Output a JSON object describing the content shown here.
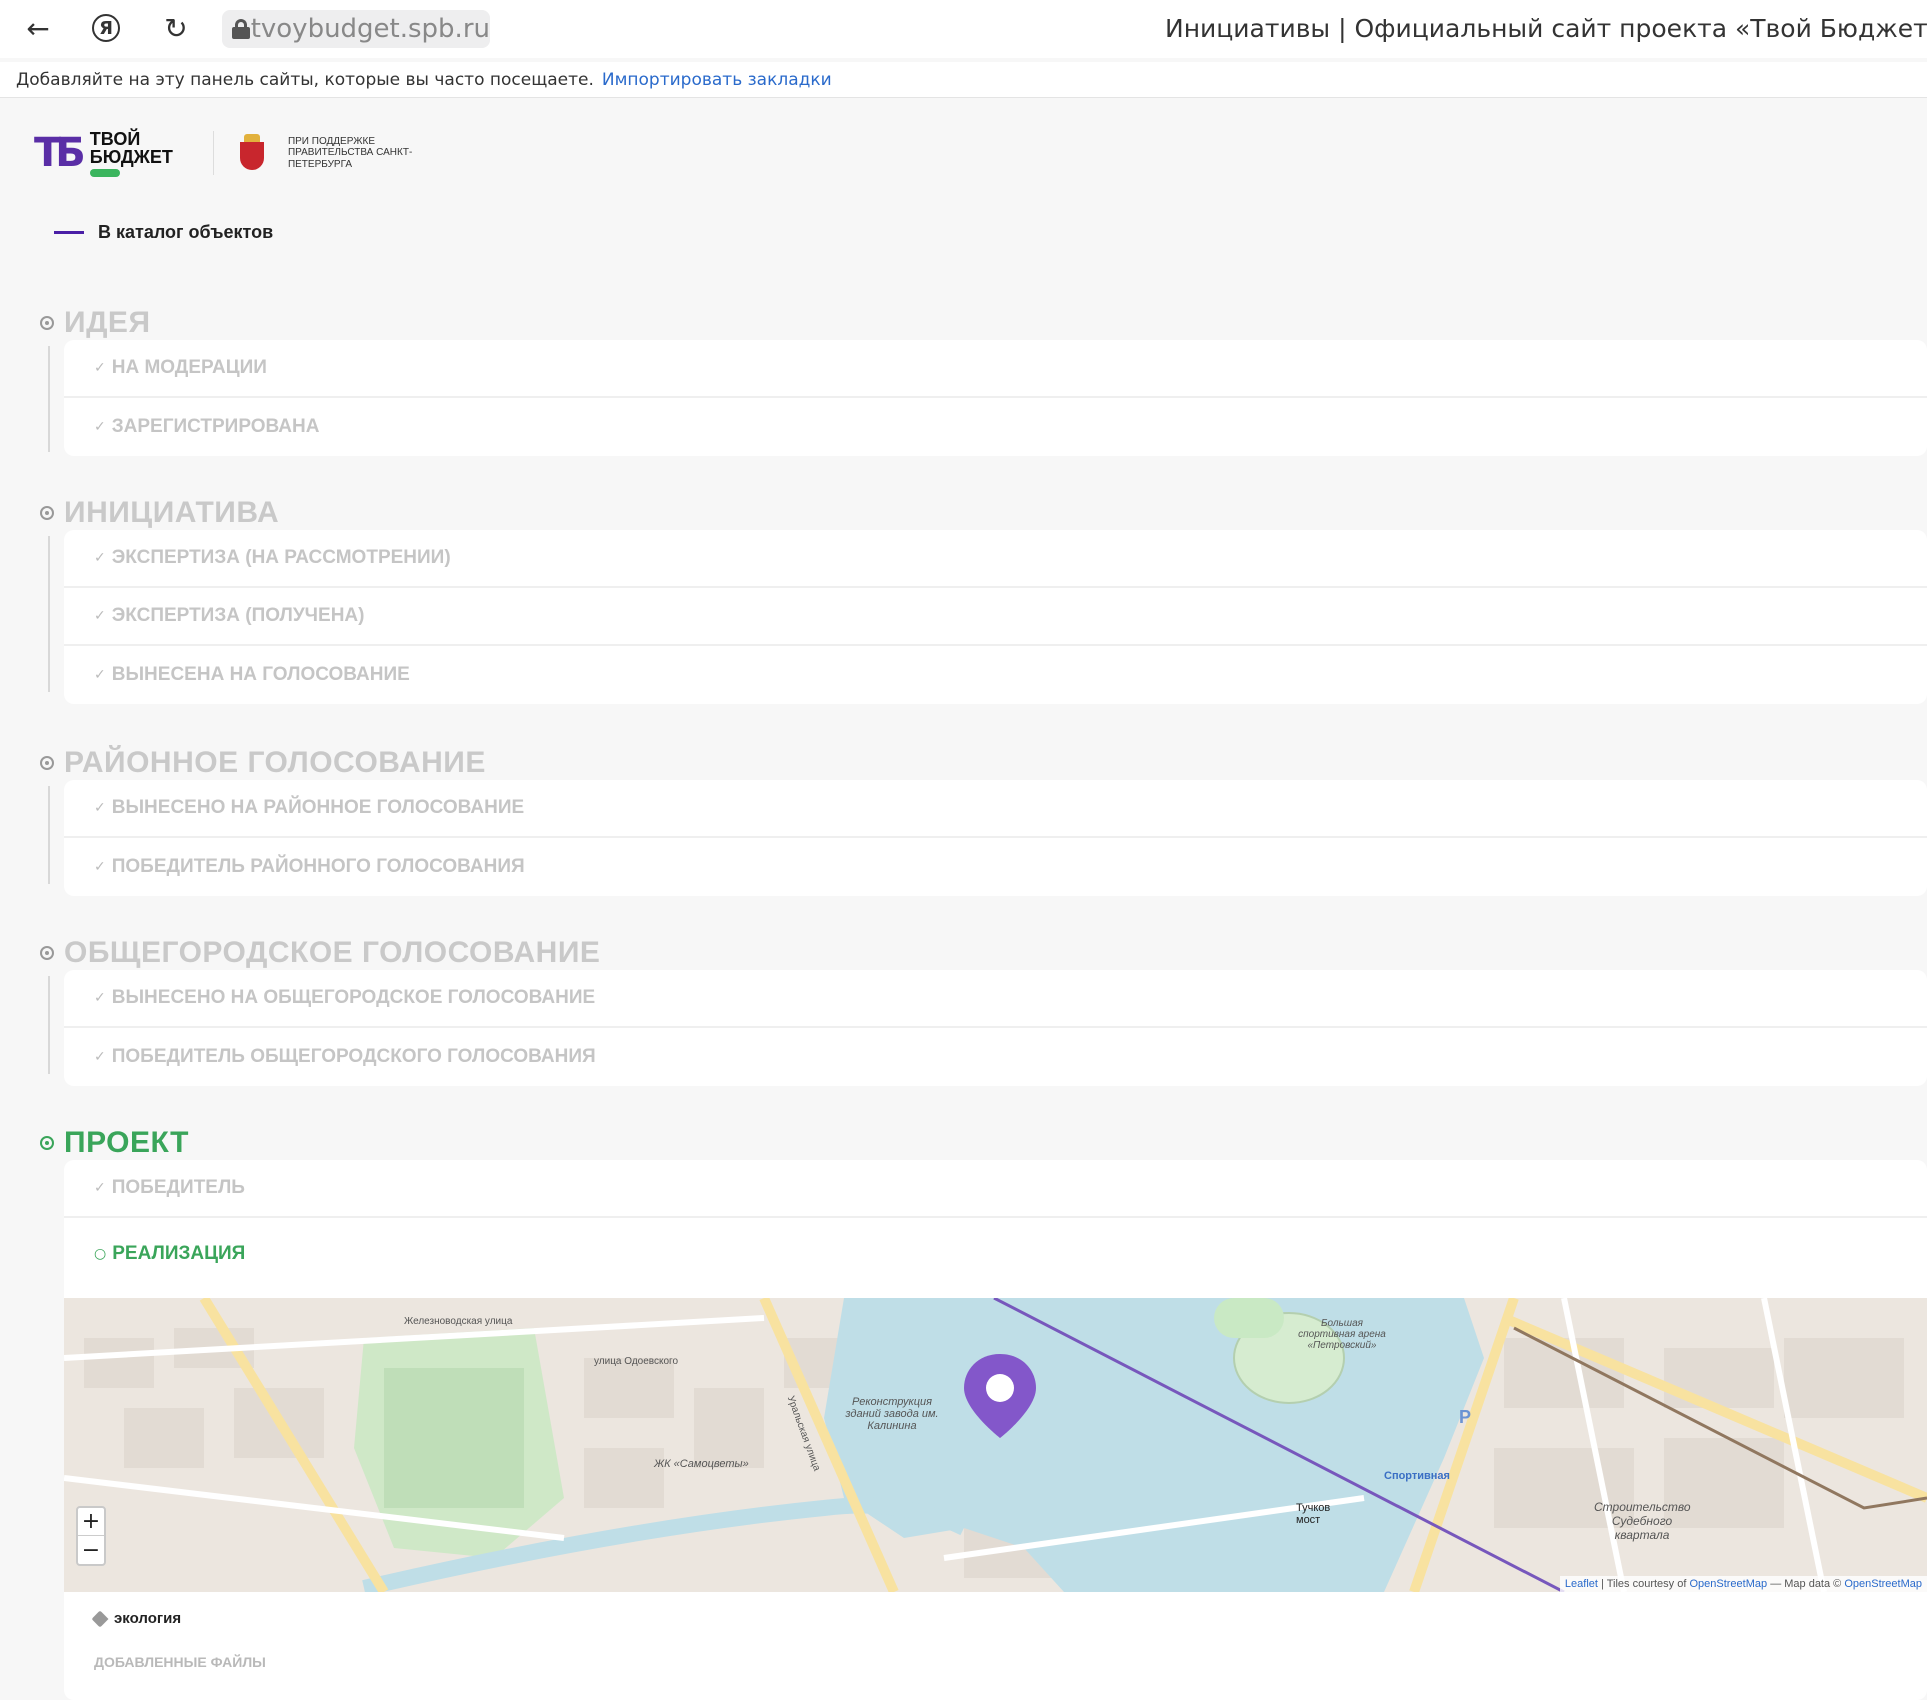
{
  "browser": {
    "url": "tvoybudget.spb.ru",
    "tab_title": "Инициативы | Официальный сайт проекта «Твой Бюджет»",
    "ya_glyph": "Я",
    "bookmarks_text": "Добавляйте на эту панель сайты, которые вы часто посещаете.",
    "bookmarks_link": "Импортировать закладки"
  },
  "site": {
    "logo_top": "ТВОЙ",
    "logo_bottom": "БЮДЖЕТ",
    "support_text": "ПРИ ПОДДЕРЖКЕ ПРАВИТЕЛЬСТВА САНКТ-ПЕТЕРБУРГА",
    "back_link": "В каталог объектов"
  },
  "stages": [
    {
      "title": "ИДЕЯ",
      "steps": [
        "НА МОДЕРАЦИИ",
        "ЗАРЕГИСТРИРОВАНА"
      ]
    },
    {
      "title": "ИНИЦИАТИВА",
      "steps": [
        "ЭКСПЕРТИЗА (НА РАССМОТРЕНИИ)",
        "ЭКСПЕРТИЗА (ПОЛУЧЕНА)",
        "ВЫНЕСЕНА НА ГОЛОСОВАНИЕ"
      ]
    },
    {
      "title": "РАЙОННОЕ ГОЛОСОВАНИЕ",
      "steps": [
        "ВЫНЕСЕНО НА РАЙОННОЕ ГОЛОСОВАНИЕ",
        "ПОБЕДИТЕЛЬ РАЙОННОГО ГОЛОСОВАНИЯ"
      ]
    },
    {
      "title": "ОБЩЕГОРОДСКОЕ ГОЛОСОВАНИЕ",
      "steps": [
        "ВЫНЕСЕНО НА ОБЩЕГОРОДСКОЕ ГОЛОСОВАНИЕ",
        "ПОБЕДИТЕЛЬ ОБЩЕГОРОДСКОГО ГОЛОСОВАНИЯ"
      ]
    },
    {
      "title": "ПРОЕКТ",
      "steps": [
        "ПОБЕДИТЕЛЬ",
        "РЕАЛИЗАЦИЯ"
      ]
    }
  ],
  "map": {
    "zoom_in": "+",
    "zoom_out": "−",
    "attribution": {
      "leaflet": "Leaflet",
      "tiles": "| Tiles courtesy of",
      "osm1": "OpenStreetMap",
      "data": "— Map data ©",
      "osm2": "OpenStreetMap"
    },
    "labels": {
      "sport": "Спортивная",
      "bridge": "Тучков мост",
      "samotsvety": "ЖК «Самоцветы»",
      "reconstruction": "Реконструкция зданий завода им. Калинина",
      "construction": "Строительство Судебного квартала",
      "arena": "Большая спортивная арена «Петровский»",
      "street1": "Железноводская улица",
      "street2": "улица Одоевского",
      "street3": "Уральская улица",
      "parking": "P"
    }
  },
  "category": "экология",
  "files_label": "ДОБАВЛЕННЫЕ ФАЙЛЫ",
  "colors": {
    "accent": "#4a1fa6",
    "active": "#3aa55a",
    "inactive": "#c9c9c9"
  }
}
